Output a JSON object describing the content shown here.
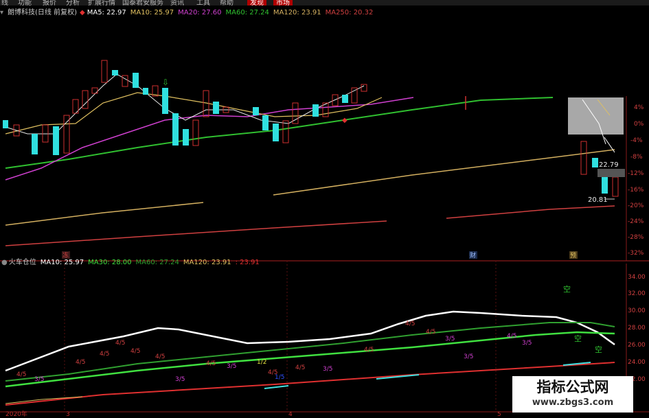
{
  "menu": [
    {
      "label": "线",
      "active": false
    },
    {
      "label": "功能",
      "active": false
    },
    {
      "label": "报价",
      "active": false
    },
    {
      "label": "分析",
      "active": false
    },
    {
      "label": "扩展行情",
      "active": false
    },
    {
      "label": "国泰君安服务",
      "active": false
    },
    {
      "label": "资讯",
      "active": false
    },
    {
      "label": "工具",
      "active": false
    },
    {
      "label": "帮助",
      "active": false
    },
    {
      "label": "发现",
      "active": true
    },
    {
      "label": "市场",
      "active": true
    }
  ],
  "main_chart": {
    "title": "朗博科技(日线 前复权)",
    "ma5": "MA5: 22.97",
    "ma10": "MA10: 25.97",
    "ma20": "MA20: 27.60",
    "ma60": "MA60: 27.24",
    "ma120": "MA120: 23.91",
    "ma250": "MA250: 20.32",
    "price_high_label": "22.79",
    "price_low_label": "20.81",
    "pct_ticks": [
      "4%",
      "0%",
      "-4%",
      "-8%",
      "-12%",
      "-16%",
      "-20%",
      "-24%",
      "-28%",
      "-32%"
    ],
    "event_markers": [
      "冻",
      "财",
      "预"
    ],
    "colors": {
      "ma5": "#ffffff",
      "ma10": "#e0c060",
      "ma20": "#d040d0",
      "ma60": "#30c030",
      "ma120": "#d4b060",
      "ma250": "#d04040",
      "up": "#d03030",
      "down": "#30e0e0"
    }
  },
  "sub_chart": {
    "title": "火车仓位",
    "ma10": "MA10: 25.97",
    "ma30": "MA30: 28.00",
    "ma60": "MA60: 27.24",
    "ma120": "MA120: 23.91",
    "extra": ": 23.91",
    "y_ticks": [
      "34.00",
      "32.00",
      "30.00",
      "28.00",
      "26.00",
      "24.00",
      "22.00"
    ],
    "signal_labels": [
      "4/5",
      "3/5",
      "1/5",
      "1/2",
      "空"
    ],
    "date_label": "2020年",
    "month_labels": [
      "3",
      "4",
      "5"
    ]
  },
  "watermark": {
    "title": "指标公式网",
    "url": "www.zbgs3.com"
  }
}
